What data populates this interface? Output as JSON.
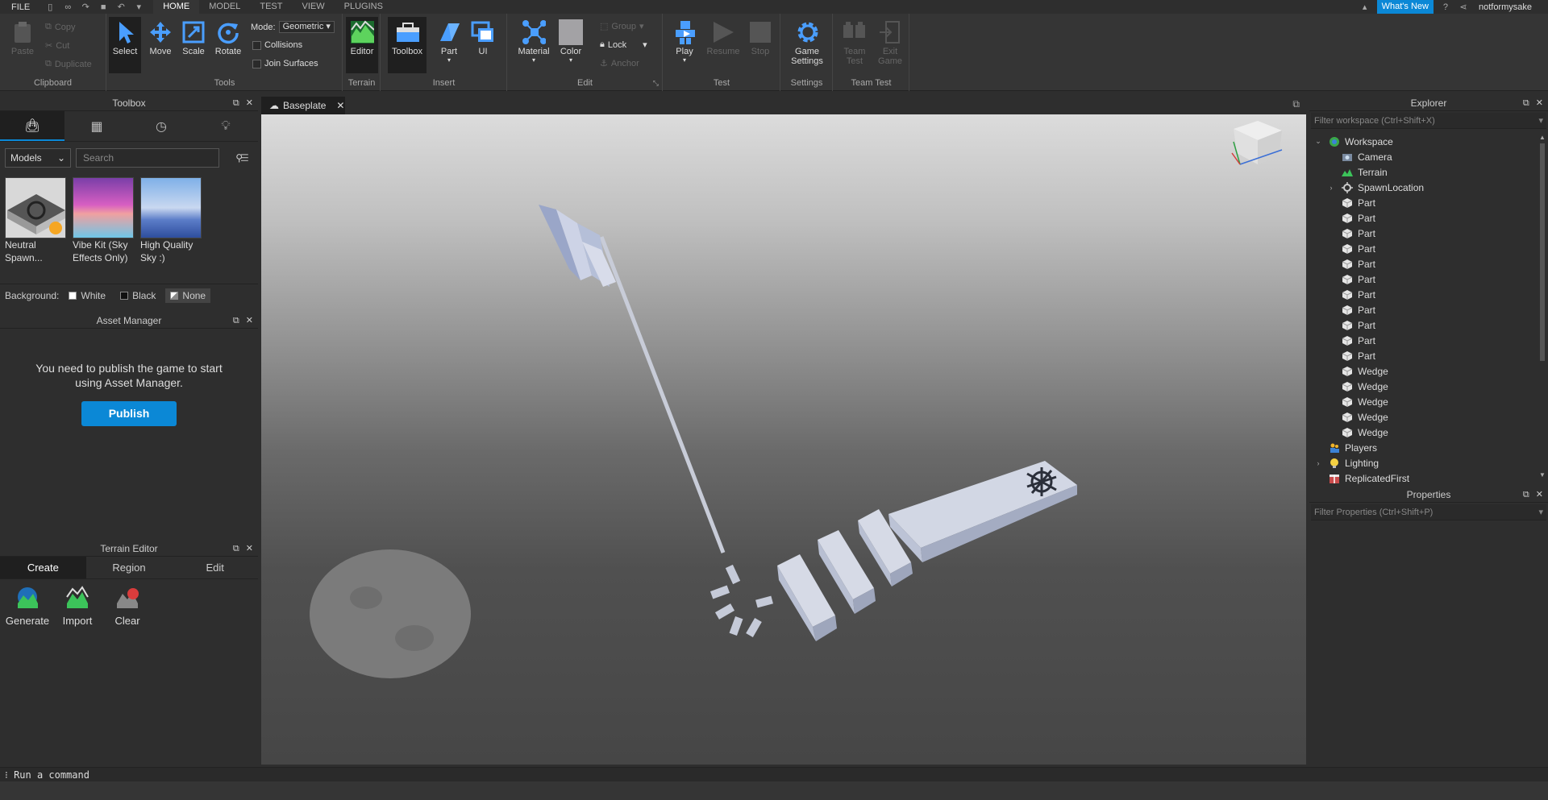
{
  "menubar": {
    "file": "FILE",
    "tabs": [
      "HOME",
      "MODEL",
      "TEST",
      "VIEW",
      "PLUGINS"
    ],
    "active_tab": "HOME",
    "whats_new": "What's New",
    "username": "notformysake"
  },
  "ribbon": {
    "clipboard": {
      "label": "Clipboard",
      "paste": "Paste",
      "copy": "Copy",
      "cut": "Cut",
      "duplicate": "Duplicate"
    },
    "tools": {
      "label": "Tools",
      "select": "Select",
      "move": "Move",
      "scale": "Scale",
      "rotate": "Rotate",
      "mode_label": "Mode:",
      "mode_value": "Geometric",
      "collisions": "Collisions",
      "join_surfaces": "Join Surfaces"
    },
    "terrain": {
      "label": "Terrain",
      "editor": "Editor"
    },
    "insert": {
      "label": "Insert",
      "toolbox": "Toolbox",
      "part": "Part",
      "ui": "UI"
    },
    "edit": {
      "label": "Edit",
      "material": "Material",
      "color": "Color",
      "group": "Group",
      "lock": "Lock",
      "anchor": "Anchor"
    },
    "test": {
      "label": "Test",
      "play": "Play",
      "resume": "Resume",
      "stop": "Stop"
    },
    "settings": {
      "label": "Settings",
      "game_settings_1": "Game",
      "game_settings_2": "Settings"
    },
    "team_test": {
      "label": "Team Test",
      "team_1": "Team",
      "team_2": "Test",
      "exit_1": "Exit",
      "exit_2": "Game"
    }
  },
  "toolbox": {
    "title": "Toolbox",
    "category": "Models",
    "search_placeholder": "Search",
    "items": [
      {
        "name_1": "Neutral",
        "name_2": "Spawn..."
      },
      {
        "name_1": "Vibe Kit (Sky",
        "name_2": "Effects Only)"
      },
      {
        "name_1": "High Quality",
        "name_2": "Sky :)"
      }
    ],
    "background_label": "Background:",
    "bg_white": "White",
    "bg_black": "Black",
    "bg_none": "None"
  },
  "asset_manager": {
    "title": "Asset Manager",
    "message_1": "You need to publish the game to start",
    "message_2": "using Asset Manager.",
    "publish": "Publish"
  },
  "terrain_editor": {
    "title": "Terrain Editor",
    "tabs": [
      "Create",
      "Region",
      "Edit"
    ],
    "tools": [
      "Generate",
      "Import",
      "Clear"
    ]
  },
  "document": {
    "tab": "Baseplate"
  },
  "explorer": {
    "title": "Explorer",
    "filter_placeholder": "Filter workspace (Ctrl+Shift+X)",
    "items": [
      {
        "label": "Workspace",
        "depth": 0,
        "expanded": "open",
        "icon": "workspace-icon"
      },
      {
        "label": "Camera",
        "depth": 1,
        "expanded": "",
        "icon": "camera-icon"
      },
      {
        "label": "Terrain",
        "depth": 1,
        "expanded": "",
        "icon": "terrain-icon"
      },
      {
        "label": "SpawnLocation",
        "depth": 1,
        "expanded": "closed",
        "icon": "spawn-icon"
      },
      {
        "label": "Part",
        "depth": 1,
        "expanded": "",
        "icon": "part-icon"
      },
      {
        "label": "Part",
        "depth": 1,
        "expanded": "",
        "icon": "part-icon"
      },
      {
        "label": "Part",
        "depth": 1,
        "expanded": "",
        "icon": "part-icon"
      },
      {
        "label": "Part",
        "depth": 1,
        "expanded": "",
        "icon": "part-icon"
      },
      {
        "label": "Part",
        "depth": 1,
        "expanded": "",
        "icon": "part-icon"
      },
      {
        "label": "Part",
        "depth": 1,
        "expanded": "",
        "icon": "part-icon"
      },
      {
        "label": "Part",
        "depth": 1,
        "expanded": "",
        "icon": "part-icon"
      },
      {
        "label": "Part",
        "depth": 1,
        "expanded": "",
        "icon": "part-icon"
      },
      {
        "label": "Part",
        "depth": 1,
        "expanded": "",
        "icon": "part-icon"
      },
      {
        "label": "Part",
        "depth": 1,
        "expanded": "",
        "icon": "part-icon"
      },
      {
        "label": "Part",
        "depth": 1,
        "expanded": "",
        "icon": "part-icon"
      },
      {
        "label": "Wedge",
        "depth": 1,
        "expanded": "",
        "icon": "wedge-icon"
      },
      {
        "label": "Wedge",
        "depth": 1,
        "expanded": "",
        "icon": "wedge-icon"
      },
      {
        "label": "Wedge",
        "depth": 1,
        "expanded": "",
        "icon": "wedge-icon"
      },
      {
        "label": "Wedge",
        "depth": 1,
        "expanded": "",
        "icon": "wedge-icon"
      },
      {
        "label": "Wedge",
        "depth": 1,
        "expanded": "",
        "icon": "wedge-icon"
      },
      {
        "label": "Players",
        "depth": 0,
        "expanded": "",
        "icon": "players-icon"
      },
      {
        "label": "Lighting",
        "depth": 0,
        "expanded": "closed",
        "icon": "lighting-icon"
      },
      {
        "label": "ReplicatedFirst",
        "depth": 0,
        "expanded": "",
        "icon": "replicated-icon"
      }
    ]
  },
  "properties": {
    "title": "Properties",
    "filter_placeholder": "Filter Properties (Ctrl+Shift+P)"
  },
  "command_bar": {
    "placeholder": "Run a command"
  },
  "colors": {
    "accent": "#0b88d6",
    "panel": "#2e2e2e",
    "ribbon": "#353535"
  }
}
